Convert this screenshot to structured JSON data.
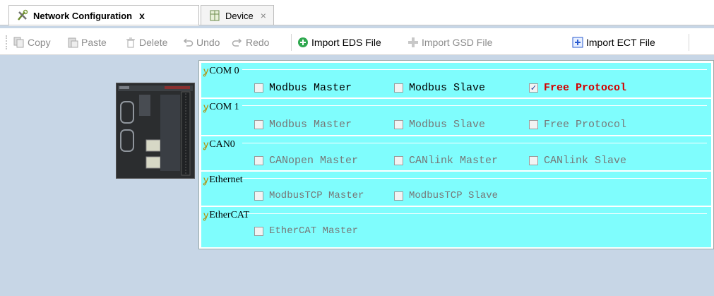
{
  "tabs": [
    {
      "label": "Network Configuration",
      "close": "x",
      "icon": "tools-icon",
      "active": true
    },
    {
      "label": "Device",
      "close": "×",
      "icon": "device-icon",
      "active": false
    }
  ],
  "toolbar": {
    "copy": "Copy",
    "paste": "Paste",
    "delete": "Delete",
    "undo": "Undo",
    "redo": "Redo",
    "import_eds": "Import EDS File",
    "import_gsd": "Import GSD File",
    "import_ect": "Import ECT File"
  },
  "groups": [
    {
      "title": "COM 0",
      "options": [
        {
          "label": "Modbus Master",
          "checked": false
        },
        {
          "label": "Modbus Slave",
          "checked": false
        },
        {
          "label": "Free Protocol",
          "checked": true
        }
      ]
    },
    {
      "title": "COM 1",
      "options": [
        {
          "label": "Modbus Master",
          "checked": false
        },
        {
          "label": "Modbus Slave",
          "checked": false
        },
        {
          "label": "Free Protocol",
          "checked": false
        }
      ]
    },
    {
      "title": "CAN0",
      "options": [
        {
          "label": "CANopen Master",
          "checked": false
        },
        {
          "label": "CANlink Master",
          "checked": false
        },
        {
          "label": "CANlink Slave",
          "checked": false
        }
      ]
    },
    {
      "title": "Ethernet",
      "options": [
        {
          "label": "ModbusTCP Master",
          "checked": false
        },
        {
          "label": "ModbusTCP Slave",
          "checked": false
        }
      ]
    },
    {
      "title": "EtherCAT",
      "options": [
        {
          "label": "EtherCAT Master",
          "checked": false
        }
      ]
    }
  ],
  "colors": {
    "panel_bg": "#7ffdfd",
    "checked_text": "#d30000",
    "background": "#c7d6e6"
  }
}
